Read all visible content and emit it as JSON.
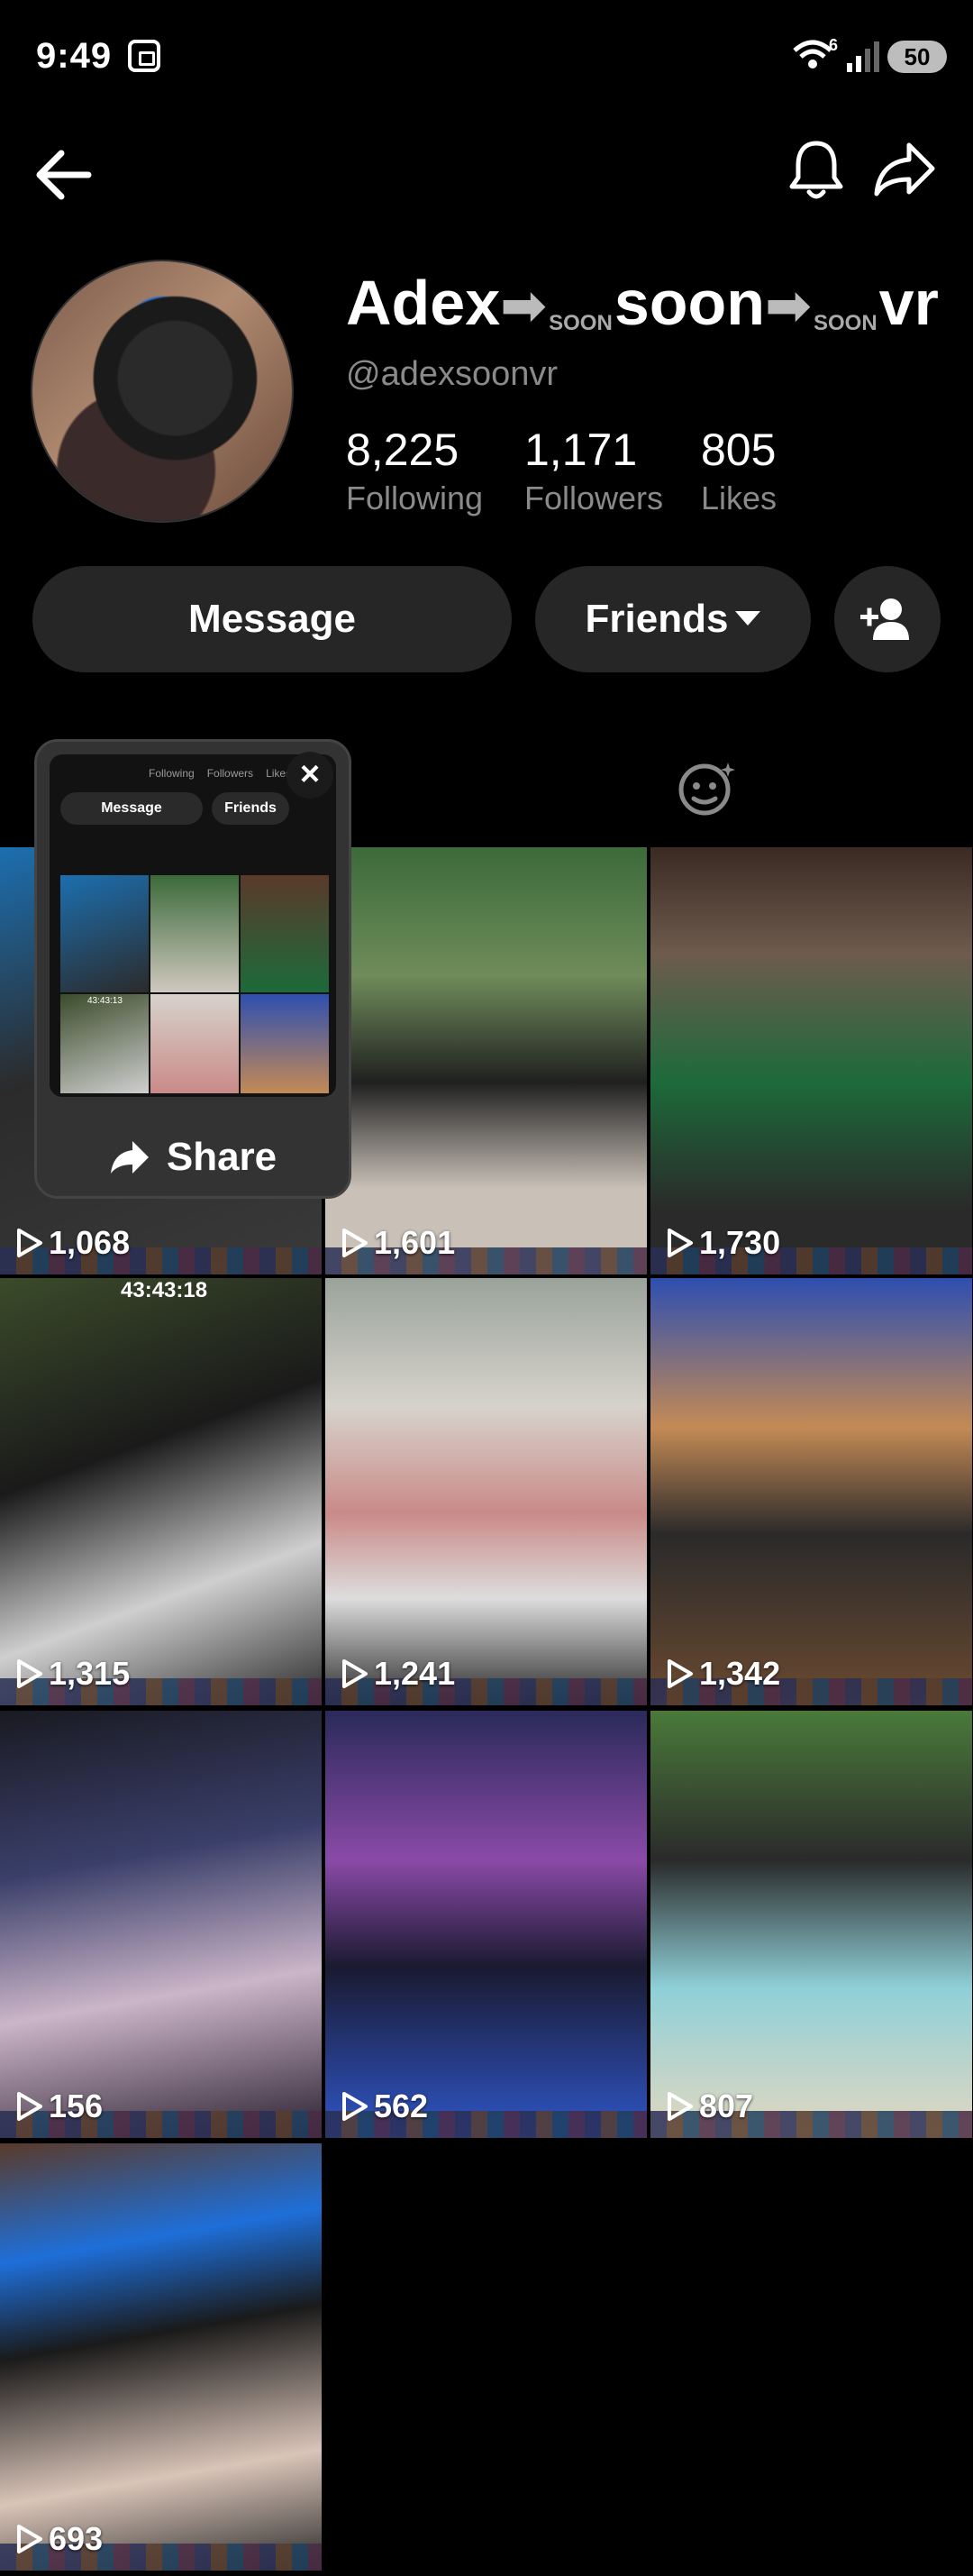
{
  "status": {
    "time": "9:49",
    "wifi_label": "6",
    "battery": "50"
  },
  "profile": {
    "name_parts": [
      "Adex",
      "soon",
      "vr"
    ],
    "soon_label": "SOON",
    "handle": "@adexsoonvr",
    "stats": [
      {
        "value": "8,225",
        "label": "Following"
      },
      {
        "value": "1,171",
        "label": "Followers"
      },
      {
        "value": "805",
        "label": "Likes"
      }
    ]
  },
  "actions": {
    "message": "Message",
    "friends": "Friends"
  },
  "popup": {
    "share_label": "Share",
    "close": "×",
    "mini_stats": [
      "Following",
      "Followers",
      "Likes"
    ],
    "mini_message": "Message",
    "mini_friends": "Friends",
    "mini_timestamp": "43:43:13"
  },
  "videos": [
    {
      "views": "1,068"
    },
    {
      "views": "1,601"
    },
    {
      "views": "1,730"
    },
    {
      "views": "1,315",
      "overlay": "43:43:18"
    },
    {
      "views": "1,241"
    },
    {
      "views": "1,342"
    },
    {
      "views": "156"
    },
    {
      "views": "562"
    },
    {
      "views": "807"
    },
    {
      "views": "693"
    }
  ],
  "icons": [
    "back-arrow-icon",
    "bell-icon",
    "share-arrow-icon",
    "add-friend-icon",
    "repost-tab-icon",
    "play-icon"
  ]
}
